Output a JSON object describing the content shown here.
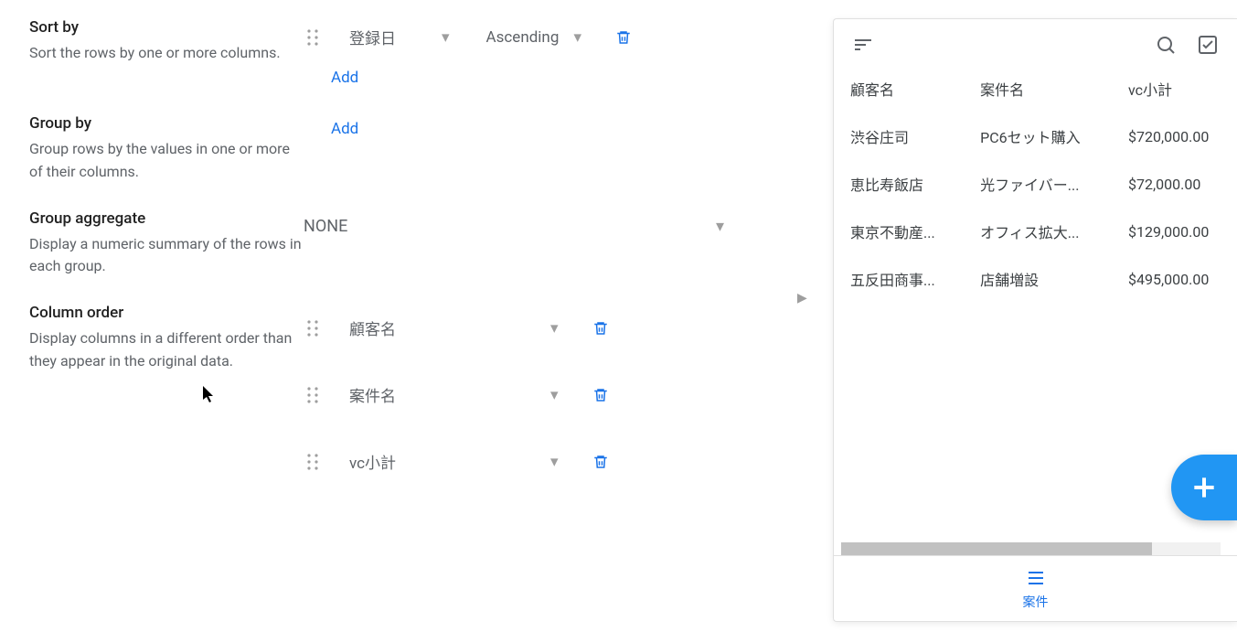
{
  "sections": {
    "sort": {
      "title": "Sort by",
      "desc": "Sort the rows by one or more columns.",
      "field": "登録日",
      "direction": "Ascending",
      "add": "Add"
    },
    "group": {
      "title": "Group by",
      "desc": "Group rows by the values in one or more of their columns.",
      "add": "Add"
    },
    "aggregate": {
      "title": "Group aggregate",
      "desc": "Display a numeric summary of the rows in each group.",
      "value": "NONE"
    },
    "column_order": {
      "title": "Column order",
      "desc": "Display columns in a different order than they appear in the original data.",
      "items": [
        "顧客名",
        "案件名",
        "vc小計"
      ]
    }
  },
  "preview": {
    "headers": [
      "顧客名",
      "案件名",
      "vc小計"
    ],
    "rows": [
      {
        "c0": "渋谷庄司",
        "c1": "PC6セット購入",
        "c2": "$720,000.00"
      },
      {
        "c0": "恵比寿飯店",
        "c1": "光ファイバー...",
        "c2": "$72,000.00"
      },
      {
        "c0": "東京不動産...",
        "c1": "オフィス拡大...",
        "c2": "$129,000.00"
      },
      {
        "c0": "五反田商事...",
        "c1": "店舗増設",
        "c2": "$495,000.00"
      }
    ],
    "nav_label": "案件"
  }
}
